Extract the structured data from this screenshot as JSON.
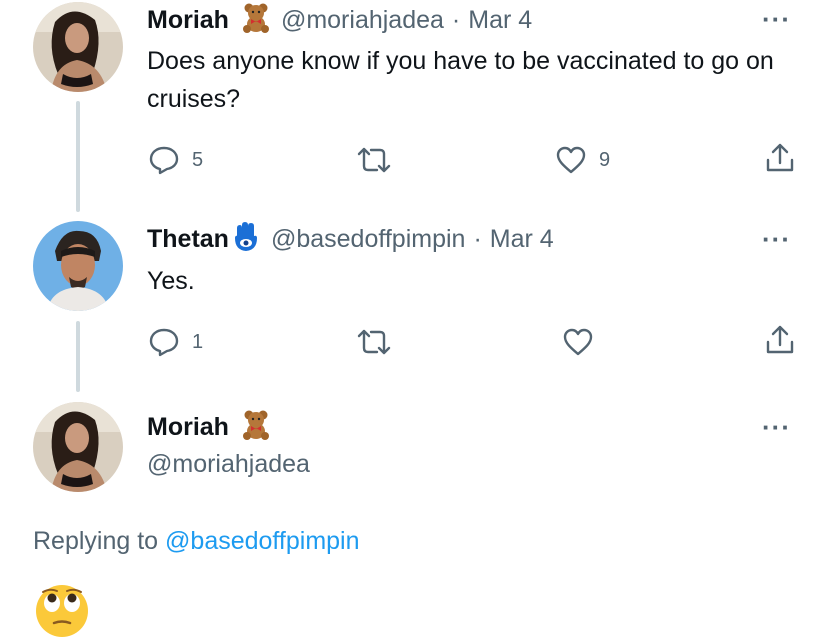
{
  "tweets": [
    {
      "name": "Moriah",
      "handle": "@moriahjadea",
      "sep": "·",
      "date": "Mar 4",
      "badge": "teddy-bear-emoji",
      "text": "Does anyone know if you have to be vaccinated to go on cruises?",
      "replies": "5",
      "retweets": "",
      "likes": "9"
    },
    {
      "name": "Thetan",
      "handle": "@basedoffpimpin",
      "sep": "·",
      "date": "Mar 4",
      "badge": "hamsa-emoji",
      "text": "Yes.",
      "replies": "1",
      "retweets": "",
      "likes": ""
    }
  ],
  "focused": {
    "name": "Moriah",
    "handle": "@moriahjadea",
    "badge": "teddy-bear-emoji",
    "replying_prefix": "Replying to",
    "replying_handle": "@basedoffpimpin",
    "body_emoji": "face-with-rolling-eyes"
  },
  "colors": {
    "accent": "#1d9bf0",
    "muted": "#536471",
    "line": "#cfd9de"
  }
}
